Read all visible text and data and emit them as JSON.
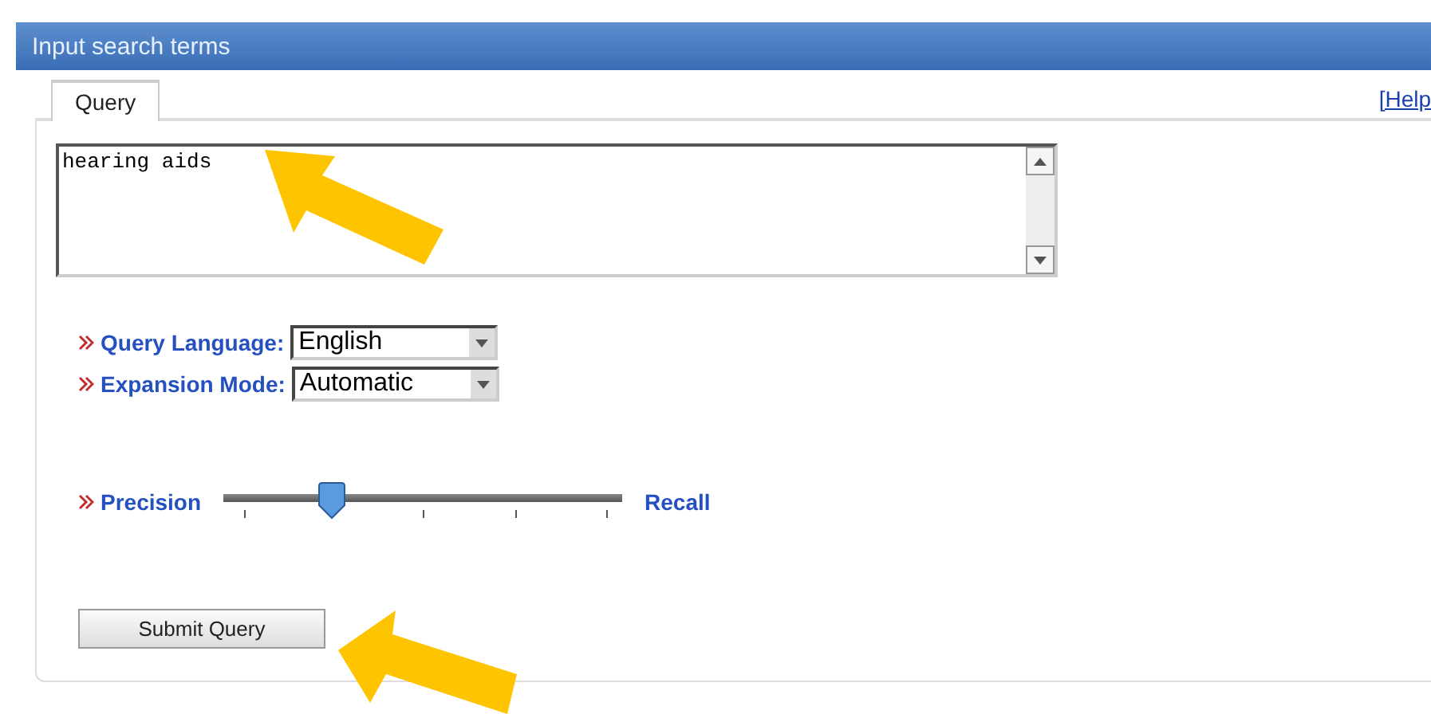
{
  "header": {
    "title": "Input search terms"
  },
  "tabs": [
    {
      "label": "Query",
      "selected": true
    }
  ],
  "help_link": "[Help",
  "query": {
    "value": "hearing aids"
  },
  "fields": [
    {
      "label": "Query Language:",
      "value": "English"
    },
    {
      "label": "Expansion Mode:",
      "value": "Automatic"
    }
  ],
  "slider": {
    "left_label": "Precision",
    "right_label": "Recall",
    "level": 0.27
  },
  "submit_button": "Submit Query"
}
